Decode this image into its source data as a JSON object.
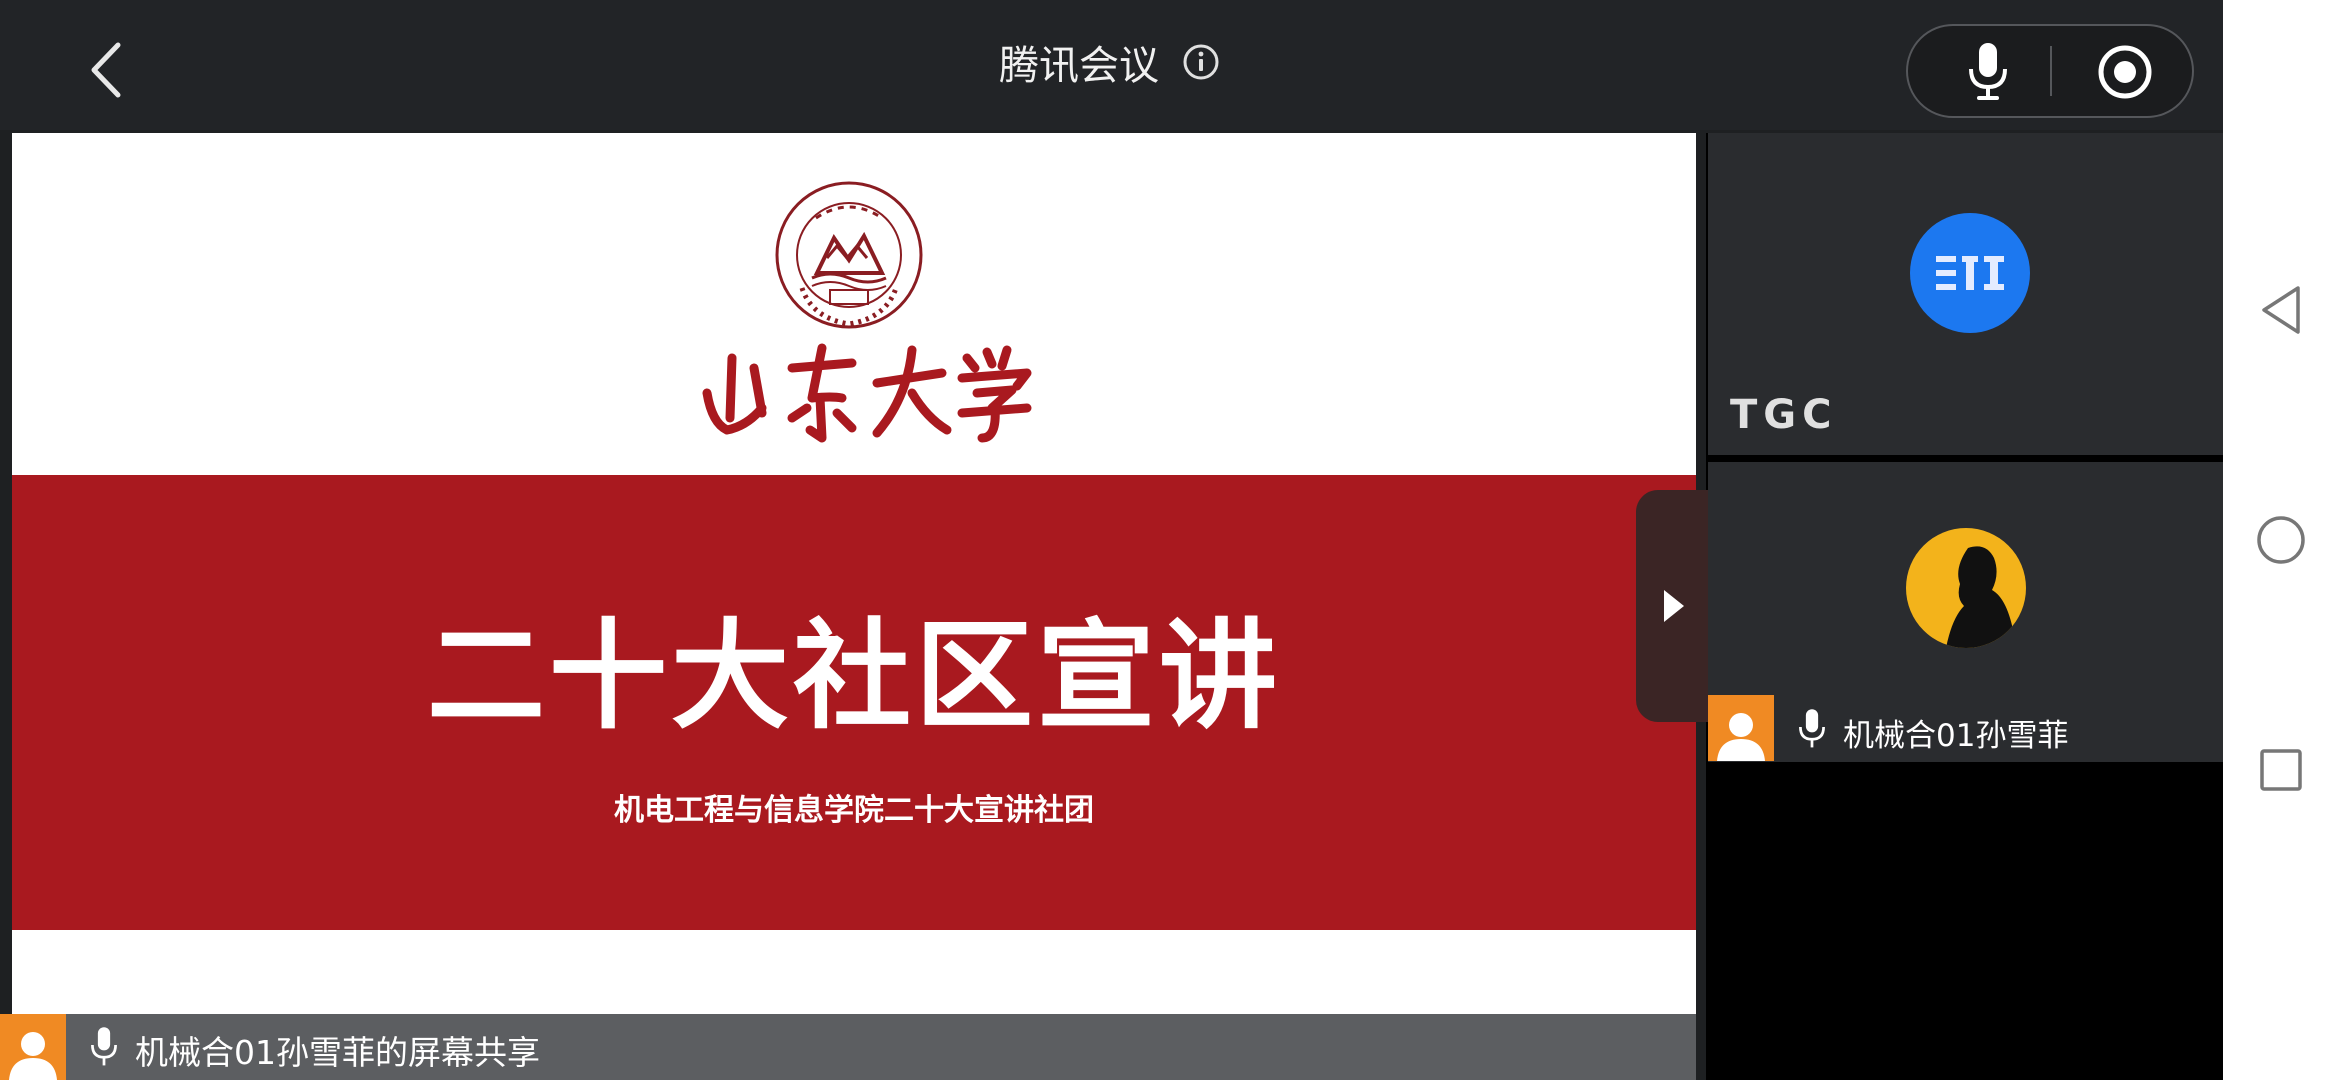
{
  "header": {
    "title": "腾讯会议",
    "back_icon": "chevron-left-icon",
    "info_icon": "info-icon",
    "mic_icon": "microphone-icon",
    "record_icon": "record-icon"
  },
  "slide": {
    "calligraphy": "山东大学",
    "heading": "二十大社区宣讲",
    "subtitle": "机电工程与信息学院二十大宣讲社团",
    "band_color": "#a9191f"
  },
  "share_bar": {
    "label": "机械合01孙雪菲的屏幕共享"
  },
  "participants": [
    {
      "name": "TGC",
      "avatar_color": "#1c78f0"
    },
    {
      "name": "机械合01孙雪菲",
      "avatar_color": "#f3b31b"
    }
  ],
  "system_nav": {
    "back_icon": "triangle-back-icon",
    "home_icon": "circle-home-icon",
    "recents_icon": "square-recents-icon"
  }
}
